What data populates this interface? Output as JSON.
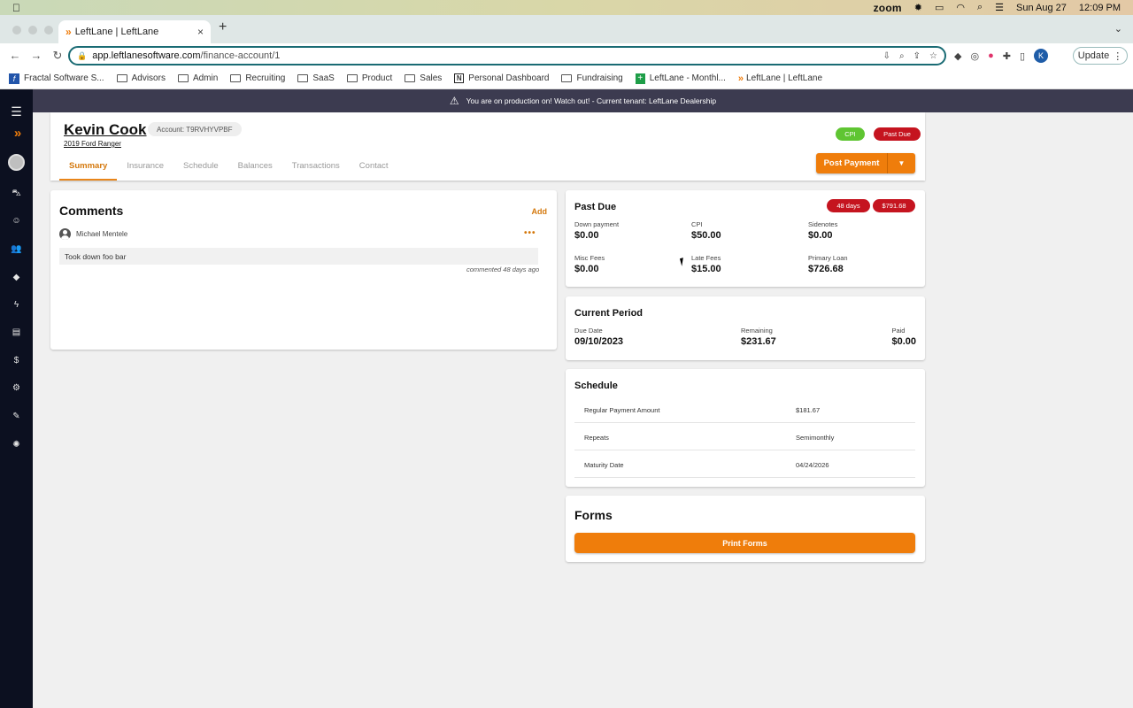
{
  "menubar": {
    "app": "zoom",
    "date": "Sun Aug 27",
    "time": "12:09 PM"
  },
  "browser": {
    "tab_title": "LeftLane | LeftLane",
    "tab_close": "×",
    "new_tab": "+",
    "url_host": "app.leftlanesoftware.com",
    "url_path": "/finance-account/1",
    "profile_initial": "K",
    "update_label": "Update"
  },
  "bookmarks": [
    {
      "label": "Fractal Software S...",
      "icon": "fractal-icon"
    },
    {
      "label": "Advisors",
      "icon": "folder-icon"
    },
    {
      "label": "Admin",
      "icon": "folder-icon"
    },
    {
      "label": "Recruiting",
      "icon": "folder-icon"
    },
    {
      "label": "SaaS",
      "icon": "folder-icon"
    },
    {
      "label": "Product",
      "icon": "folder-icon"
    },
    {
      "label": "Sales",
      "icon": "folder-icon"
    },
    {
      "label": "Personal Dashboard",
      "icon": "notion-icon"
    },
    {
      "label": "Fundraising",
      "icon": "folder-icon"
    },
    {
      "label": "LeftLane - Monthl...",
      "icon": "sheets-icon"
    },
    {
      "label": "LeftLane | LeftLane",
      "icon": "leftlane-icon"
    }
  ],
  "banner": {
    "text": "You are on production on! Watch out! - Current tenant: LeftLane Dealership"
  },
  "customer": {
    "name": "Kevin Cook",
    "vehicle": "2019 Ford Ranger",
    "account": "Account: T9RVHYVPBF",
    "badge_cpi": "CPI",
    "badge_past_due": "Past Due",
    "post_payment": "Post Payment"
  },
  "tabs": [
    "Summary",
    "Insurance",
    "Schedule",
    "Balances",
    "Transactions",
    "Contact"
  ],
  "comments": {
    "title": "Comments",
    "add": "Add",
    "author": "Michael Mentele",
    "menu": "•••",
    "text": "Took down foo bar",
    "time": "commented 48 days ago"
  },
  "past_due": {
    "title": "Past Due",
    "days_badge": "48 days",
    "amount_badge": "$791.68",
    "items": [
      {
        "label": "Down payment",
        "value": "$0.00"
      },
      {
        "label": "CPI",
        "value": "$50.00"
      },
      {
        "label": "Sidenotes",
        "value": "$0.00"
      },
      {
        "label": "Misc Fees",
        "value": "$0.00"
      },
      {
        "label": "Late Fees",
        "value": "$15.00"
      },
      {
        "label": "Primary Loan",
        "value": "$726.68"
      }
    ]
  },
  "current_period": {
    "title": "Current Period",
    "due_label": "Due Date",
    "due_value": "09/10/2023",
    "remaining_label": "Remaining",
    "remaining_value": "$231.67",
    "paid_label": "Paid",
    "paid_value": "$0.00"
  },
  "schedule": {
    "title": "Schedule",
    "rows": [
      {
        "label": "Regular Payment Amount",
        "value": "$181.67"
      },
      {
        "label": "Repeats",
        "value": "Semimonthly"
      },
      {
        "label": "Maturity Date",
        "value": "04/24/2026"
      }
    ]
  },
  "forms": {
    "title": "Forms",
    "print": "Print Forms"
  },
  "colors": {
    "accent": "#ef7d0b",
    "danger": "#c5141f",
    "success": "#5fc532",
    "nav": "#0c1020",
    "banner": "#3c3b50"
  }
}
